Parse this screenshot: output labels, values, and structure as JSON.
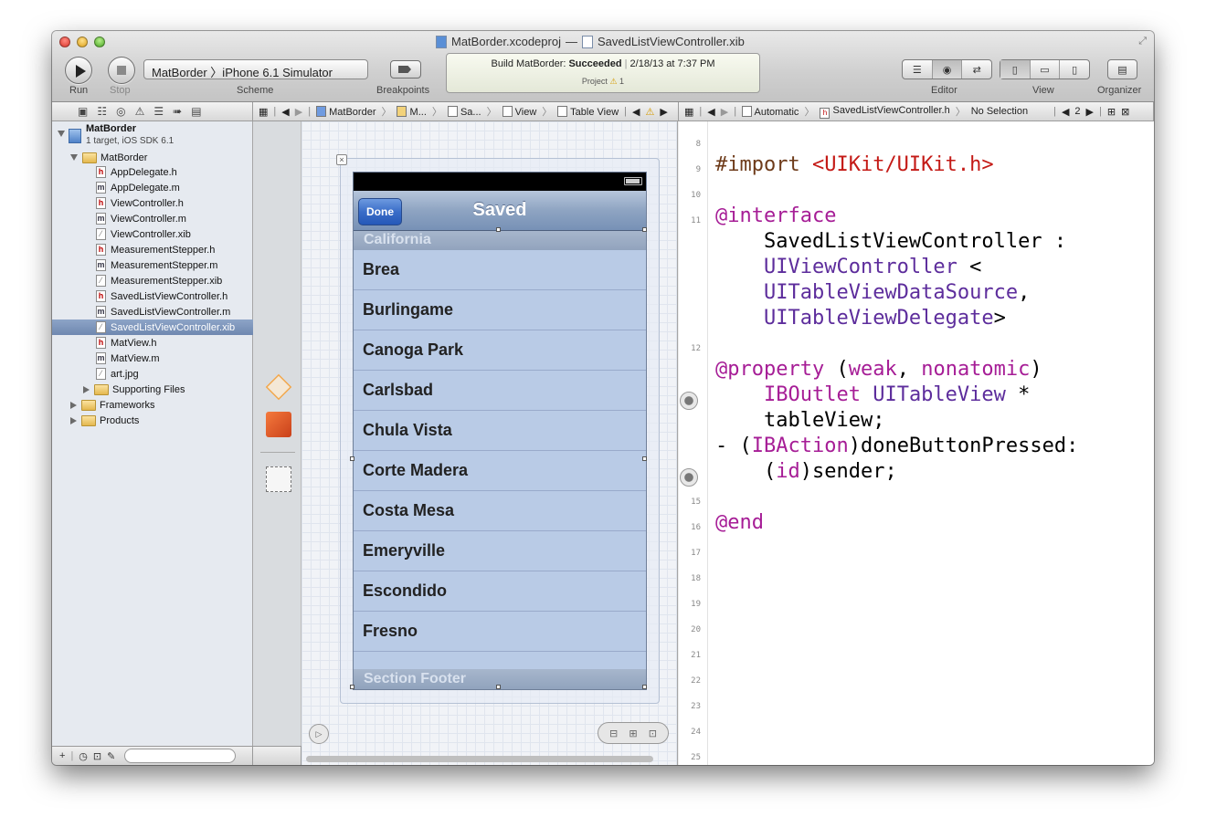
{
  "window": {
    "project_file": "MatBorder.xcodeproj",
    "title_separator": "—",
    "open_file": "SavedListViewController.xib"
  },
  "toolbar": {
    "run_label": "Run",
    "stop_label": "Stop",
    "scheme_label": "Scheme",
    "scheme_value": "MatBorder 〉iPhone 6.1 Simulator",
    "breakpoints_label": "Breakpoints",
    "status_prefix": "Build MatBorder: ",
    "status_result": "Succeeded",
    "status_time": "2/18/13 at 7:37 PM",
    "status_project": "Project",
    "warning_count": "1",
    "editor_label": "Editor",
    "view_label": "View",
    "organizer_label": "Organizer"
  },
  "jumpbar_ib": [
    "MatBorder",
    "M...",
    "Sa...",
    "View",
    "Table View"
  ],
  "jumpbar_code": {
    "mode": "Automatic",
    "file": "SavedListViewController.h",
    "selection": "No Selection",
    "counter": "2"
  },
  "navigator": {
    "project": {
      "name": "MatBorder",
      "subtitle": "1 target, iOS SDK 6.1"
    },
    "group": "MatBorder",
    "files": [
      {
        "name": "AppDelegate.h",
        "type": "h"
      },
      {
        "name": "AppDelegate.m",
        "type": "m"
      },
      {
        "name": "ViewController.h",
        "type": "h"
      },
      {
        "name": "ViewController.m",
        "type": "m"
      },
      {
        "name": "ViewController.xib",
        "type": "x"
      },
      {
        "name": "MeasurementStepper.h",
        "type": "h"
      },
      {
        "name": "MeasurementStepper.m",
        "type": "m"
      },
      {
        "name": "MeasurementStepper.xib",
        "type": "x"
      },
      {
        "name": "SavedListViewController.h",
        "type": "h"
      },
      {
        "name": "SavedListViewController.m",
        "type": "m"
      },
      {
        "name": "SavedListViewController.xib",
        "type": "x",
        "selected": true
      },
      {
        "name": "MatView.h",
        "type": "h"
      },
      {
        "name": "MatView.m",
        "type": "m"
      },
      {
        "name": "art.jpg",
        "type": "x"
      }
    ],
    "supporting_files": "Supporting Files",
    "frameworks": "Frameworks",
    "products": "Products"
  },
  "ios_view": {
    "nav_title": "Saved",
    "done_button": "Done",
    "section_header": "California",
    "cells": [
      "Brea",
      "Burlingame",
      "Canoga Park",
      "Carlsbad",
      "Chula Vista",
      "Corte Madera",
      "Costa Mesa",
      "Emeryville",
      "Escondido",
      "Fresno"
    ],
    "section_footer": "Section Footer"
  },
  "editor": {
    "line_numbers": [
      "8",
      "9",
      "10",
      "11",
      "12",
      "15",
      "16",
      "17",
      "18",
      "19",
      "20",
      "21",
      "22",
      "23",
      "24",
      "25"
    ],
    "code": {
      "import_kw": "#import",
      "import_path": "<UIKit/UIKit.h>",
      "interface_kw": "@interface",
      "class_name": "SavedListViewController :",
      "superclass": "UIViewController",
      "lt": " <",
      "proto1": "UITableViewDataSource",
      "comma": ",",
      "proto2": "UITableViewDelegate",
      "gt": ">",
      "property_kw": "@property",
      "attr_open": " (",
      "weak": "weak",
      "attr_comma": ", ",
      "nonatomic": "nonatomic",
      "attr_close": ")",
      "iboutlet": "IBOutlet",
      "tableview_class": "UITableView",
      "star": " *",
      "ivar": "tableView;",
      "method_prefix": "- (",
      "ibaction": "IBAction",
      "method_name": ")doneButtonPressed:",
      "param_open": "(",
      "id_kw": "id",
      "param_rest": ")sender;",
      "end_kw": "@end"
    }
  }
}
